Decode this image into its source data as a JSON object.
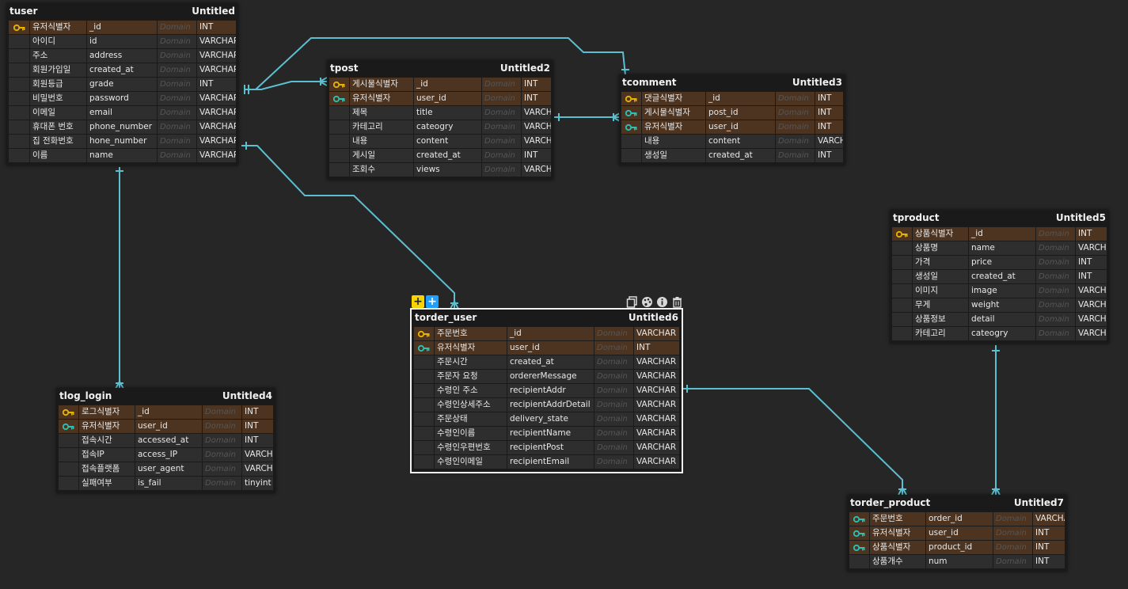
{
  "colors": {
    "edge": "#5bbfcf",
    "pk_key": "#e8b400",
    "fk_key": "#2dc0b5",
    "key_row": "#4d3420",
    "row": "#2e2e2e"
  },
  "icons": {
    "pk": "key-icon",
    "fk": "foreign-key-icon"
  },
  "tables": [
    {
      "id": "tuser",
      "name": "tuser",
      "alias": "Untitled",
      "columns": [
        {
          "icon": "pk",
          "logical": "유저식별자",
          "physical": "_id",
          "domain": "Domain",
          "type": "INT"
        },
        {
          "icon": "",
          "logical": "아이디",
          "physical": "id",
          "domain": "Domain",
          "type": "VARCHAR"
        },
        {
          "icon": "",
          "logical": "주소",
          "physical": "address",
          "domain": "Domain",
          "type": "VARCHAR"
        },
        {
          "icon": "",
          "logical": "회원가입일",
          "physical": "created_at",
          "domain": "Domain",
          "type": "VARCHAR"
        },
        {
          "icon": "",
          "logical": "회원등급",
          "physical": "grade",
          "domain": "Domain",
          "type": "INT"
        },
        {
          "icon": "",
          "logical": "비밀번호",
          "physical": "password",
          "domain": "Domain",
          "type": "VARCHAR"
        },
        {
          "icon": "",
          "logical": "이메일",
          "physical": "email",
          "domain": "Domain",
          "type": "VARCHAR"
        },
        {
          "icon": "",
          "logical": "휴대폰 번호",
          "physical": "phone_number",
          "domain": "Domain",
          "type": "VARCHAR"
        },
        {
          "icon": "",
          "logical": "집 전화번호",
          "physical": "hone_number",
          "domain": "Domain",
          "type": "VARCHAR"
        },
        {
          "icon": "",
          "logical": "이름",
          "physical": "name",
          "domain": "Domain",
          "type": "VARCHAR"
        }
      ]
    },
    {
      "id": "tpost",
      "name": "tpost",
      "alias": "Untitled2",
      "columns": [
        {
          "icon": "pk",
          "logical": "게시물식별자",
          "physical": "_id",
          "domain": "Domain",
          "type": "INT"
        },
        {
          "icon": "fk",
          "logical": "유저식별자",
          "physical": "user_id",
          "domain": "Domain",
          "type": "INT"
        },
        {
          "icon": "",
          "logical": "제목",
          "physical": "title",
          "domain": "Domain",
          "type": "VARCHAR"
        },
        {
          "icon": "",
          "logical": "카테고리",
          "physical": "cateogry",
          "domain": "Domain",
          "type": "VARCHAR"
        },
        {
          "icon": "",
          "logical": "내용",
          "physical": "content",
          "domain": "Domain",
          "type": "VARCHAR"
        },
        {
          "icon": "",
          "logical": "게시일",
          "physical": "created_at",
          "domain": "Domain",
          "type": "INT"
        },
        {
          "icon": "",
          "logical": "조회수",
          "physical": "views",
          "domain": "Domain",
          "type": "VARCHAR"
        }
      ]
    },
    {
      "id": "tcomment",
      "name": "tcomment",
      "alias": "Untitled3",
      "columns": [
        {
          "icon": "pk",
          "logical": "댓글식별자",
          "physical": "_id",
          "domain": "Domain",
          "type": "INT"
        },
        {
          "icon": "fk",
          "logical": "게시물식별자",
          "physical": "post_id",
          "domain": "Domain",
          "type": "INT"
        },
        {
          "icon": "fk",
          "logical": "유저식별자",
          "physical": "user_id",
          "domain": "Domain",
          "type": "INT"
        },
        {
          "icon": "",
          "logical": "내용",
          "physical": "content",
          "domain": "Domain",
          "type": "VARCHAR"
        },
        {
          "icon": "",
          "logical": "생성일",
          "physical": "created_at",
          "domain": "Domain",
          "type": "INT"
        }
      ]
    },
    {
      "id": "tproduct",
      "name": "tproduct",
      "alias": "Untitled5",
      "columns": [
        {
          "icon": "pk",
          "logical": "상품식별자",
          "physical": "_id",
          "domain": "Domain",
          "type": "INT"
        },
        {
          "icon": "",
          "logical": "상품명",
          "physical": "name",
          "domain": "Domain",
          "type": "VARCHAR"
        },
        {
          "icon": "",
          "logical": "가격",
          "physical": "price",
          "domain": "Domain",
          "type": "INT"
        },
        {
          "icon": "",
          "logical": "생성일",
          "physical": "created_at",
          "domain": "Domain",
          "type": "INT"
        },
        {
          "icon": "",
          "logical": "이미지",
          "physical": "image",
          "domain": "Domain",
          "type": "VARCHAR"
        },
        {
          "icon": "",
          "logical": "무게",
          "physical": "weight",
          "domain": "Domain",
          "type": "VARCHAR"
        },
        {
          "icon": "",
          "logical": "상품정보",
          "physical": "detail",
          "domain": "Domain",
          "type": "VARCHAR"
        },
        {
          "icon": "",
          "logical": "카테고리",
          "physical": "cateogry",
          "domain": "Domain",
          "type": "VARCHAR"
        }
      ]
    },
    {
      "id": "torder_user",
      "name": "torder_user",
      "alias": "Untitled6",
      "columns": [
        {
          "icon": "pk",
          "logical": "주문번호",
          "physical": "_id",
          "domain": "Domain",
          "type": "VARCHAR"
        },
        {
          "icon": "fk",
          "logical": "유저식별자",
          "physical": "user_id",
          "domain": "Domain",
          "type": "INT"
        },
        {
          "icon": "",
          "logical": "주문시간",
          "physical": "created_at",
          "domain": "Domain",
          "type": "VARCHAR"
        },
        {
          "icon": "",
          "logical": "주문자 요청",
          "physical": "ordererMessage",
          "domain": "Domain",
          "type": "VARCHAR"
        },
        {
          "icon": "",
          "logical": "수령인 주소",
          "physical": "recipientAddr",
          "domain": "Domain",
          "type": "VARCHAR"
        },
        {
          "icon": "",
          "logical": "수령인상세주소",
          "physical": "recipientAddrDetail",
          "domain": "Domain",
          "type": "VARCHAR"
        },
        {
          "icon": "",
          "logical": "주문상태",
          "physical": "delivery_state",
          "domain": "Domain",
          "type": "VARCHAR"
        },
        {
          "icon": "",
          "logical": "수령인이름",
          "physical": "recipientName",
          "domain": "Domain",
          "type": "VARCHAR"
        },
        {
          "icon": "",
          "logical": "수령인우편번호",
          "physical": "recipientPost",
          "domain": "Domain",
          "type": "VARCHAR"
        },
        {
          "icon": "",
          "logical": "수령인이메일",
          "physical": "recipientEmail",
          "domain": "Domain",
          "type": "VARCHAR"
        }
      ]
    },
    {
      "id": "tlog_login",
      "name": "tlog_login",
      "alias": "Untitled4",
      "columns": [
        {
          "icon": "pk",
          "logical": "로그식별자",
          "physical": "_id",
          "domain": "Domain",
          "type": "INT"
        },
        {
          "icon": "fk",
          "logical": "유저식별자",
          "physical": "user_id",
          "domain": "Domain",
          "type": "INT"
        },
        {
          "icon": "",
          "logical": "접속시간",
          "physical": "accessed_at",
          "domain": "Domain",
          "type": "INT"
        },
        {
          "icon": "",
          "logical": "접속IP",
          "physical": "access_IP",
          "domain": "Domain",
          "type": "VARCHAR"
        },
        {
          "icon": "",
          "logical": "접속플랫폼",
          "physical": "user_agent",
          "domain": "Domain",
          "type": "VARCHAR"
        },
        {
          "icon": "",
          "logical": "실패여부",
          "physical": "is_fail",
          "domain": "Domain",
          "type": "tinyint"
        }
      ]
    },
    {
      "id": "torder_product",
      "name": "torder_product",
      "alias": "Untitled7",
      "columns": [
        {
          "icon": "fk",
          "logical": "주문번호",
          "physical": "order_id",
          "domain": "Domain",
          "type": "VARCHAR"
        },
        {
          "icon": "fk",
          "logical": "유저식별자",
          "physical": "user_id",
          "domain": "Domain",
          "type": "INT"
        },
        {
          "icon": "fk",
          "logical": "상품식별자",
          "physical": "product_id",
          "domain": "Domain",
          "type": "INT"
        },
        {
          "icon": "",
          "logical": "상품개수",
          "physical": "num",
          "domain": "Domain",
          "type": "INT"
        }
      ]
    }
  ],
  "toolbar": {
    "add_column": "+",
    "add_index": "+",
    "icons": [
      "copy-icon",
      "palette-icon",
      "info-icon",
      "trash-icon"
    ]
  }
}
